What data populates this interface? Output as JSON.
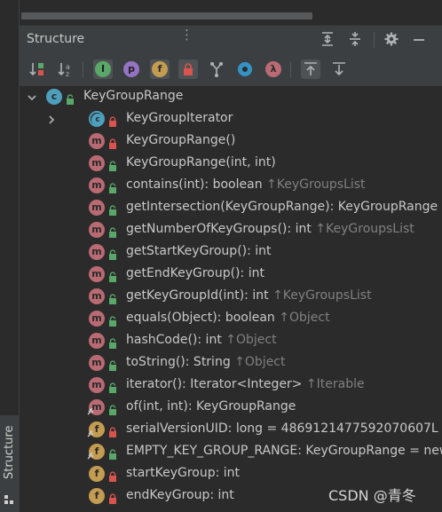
{
  "panel": {
    "title": "Structure",
    "more_glyph": "⋮",
    "colors": {
      "method": "#b96a72",
      "field": "#c39c51",
      "class": "#4e9fbd",
      "public": "#59a869",
      "private": "#d9534f",
      "selected_toggle": "#4e5254"
    }
  },
  "header_buttons": [
    "expand-all-icon",
    "collapse-all-icon",
    "gear-icon",
    "minimize-icon"
  ],
  "toolbar": [
    {
      "name": "sort-by-visibility-button",
      "icon": "sort-visibility-icon",
      "active": false
    },
    {
      "name": "sort-alphabetically-button",
      "icon": "sort-alpha-icon",
      "active": false
    },
    {
      "name": "show-inherited-button",
      "icon": "inherited-icon",
      "active": true
    },
    {
      "name": "show-properties-button",
      "icon": "property-icon",
      "active": false
    },
    {
      "name": "show-fields-button",
      "icon": "field-icon",
      "active": true
    },
    {
      "name": "show-non-public-button",
      "icon": "lock-icon",
      "active": true
    },
    {
      "name": "show-anonymous-button",
      "icon": "anonymous-icon",
      "active": false
    },
    {
      "name": "show-inherited-from-object-button",
      "icon": "object-icon",
      "active": false
    },
    {
      "name": "show-lambdas-button",
      "icon": "lambda-icon",
      "active": false
    },
    {
      "name": "autoscroll-to-source-button",
      "icon": "autoscroll-to-source-icon",
      "active": true
    },
    {
      "name": "autoscroll-from-source-button",
      "icon": "autoscroll-from-source-icon",
      "active": false
    }
  ],
  "toolbar_glyphs": {
    "inherited": "I",
    "property": "p",
    "field": "f",
    "lambda": "λ"
  },
  "tree": [
    {
      "text": "KeyGroupRange",
      "inherited": "",
      "kind": "class",
      "access": "public",
      "level": 0,
      "expander": "expanded",
      "overlay": ""
    },
    {
      "text": "KeyGroupIterator",
      "inherited": "",
      "kind": "class-inner",
      "access": "private",
      "level": 1,
      "expander": "collapsed",
      "overlay": ""
    },
    {
      "text": "KeyGroupRange()",
      "inherited": "",
      "kind": "method",
      "access": "private",
      "level": 1,
      "expander": "",
      "overlay": ""
    },
    {
      "text": "KeyGroupRange(int, int)",
      "inherited": "",
      "kind": "method",
      "access": "public",
      "level": 1,
      "expander": "",
      "overlay": ""
    },
    {
      "text": "contains(int): boolean ",
      "inherited": "↑KeyGroupsList",
      "kind": "method",
      "access": "public",
      "level": 1,
      "expander": "",
      "overlay": ""
    },
    {
      "text": "getIntersection(KeyGroupRange): KeyGroupRange",
      "inherited": "",
      "kind": "method",
      "access": "public",
      "level": 1,
      "expander": "",
      "overlay": ""
    },
    {
      "text": "getNumberOfKeyGroups(): int ",
      "inherited": "↑KeyGroupsList",
      "kind": "method",
      "access": "public",
      "level": 1,
      "expander": "",
      "overlay": ""
    },
    {
      "text": "getStartKeyGroup(): int",
      "inherited": "",
      "kind": "method",
      "access": "public",
      "level": 1,
      "expander": "",
      "overlay": ""
    },
    {
      "text": "getEndKeyGroup(): int",
      "inherited": "",
      "kind": "method",
      "access": "public",
      "level": 1,
      "expander": "",
      "overlay": ""
    },
    {
      "text": "getKeyGroupId(int): int ",
      "inherited": "↑KeyGroupsList",
      "kind": "method",
      "access": "public",
      "level": 1,
      "expander": "",
      "overlay": ""
    },
    {
      "text": "equals(Object): boolean ",
      "inherited": "↑Object",
      "kind": "method",
      "access": "public",
      "level": 1,
      "expander": "",
      "overlay": ""
    },
    {
      "text": "hashCode(): int ",
      "inherited": "↑Object",
      "kind": "method",
      "access": "public",
      "level": 1,
      "expander": "",
      "overlay": ""
    },
    {
      "text": "toString(): String ",
      "inherited": "↑Object",
      "kind": "method",
      "access": "public",
      "level": 1,
      "expander": "",
      "overlay": ""
    },
    {
      "text": "iterator(): Iterator<Integer> ",
      "inherited": "↑Iterable",
      "kind": "method",
      "access": "public",
      "level": 1,
      "expander": "",
      "overlay": ""
    },
    {
      "text": "of(int, int): KeyGroupRange",
      "inherited": "",
      "kind": "method",
      "access": "public",
      "level": 1,
      "expander": "",
      "overlay": "static"
    },
    {
      "text": "serialVersionUID: long = 4869121477592070607L",
      "inherited": "",
      "kind": "field",
      "access": "private",
      "level": 1,
      "expander": "",
      "overlay": "static"
    },
    {
      "text": "EMPTY_KEY_GROUP_RANGE: KeyGroupRange = new",
      "inherited": "",
      "kind": "field",
      "access": "public",
      "level": 1,
      "expander": "",
      "overlay": "static"
    },
    {
      "text": "startKeyGroup: int",
      "inherited": "",
      "kind": "field",
      "access": "private",
      "level": 1,
      "expander": "",
      "overlay": ""
    },
    {
      "text": "endKeyGroup: int",
      "inherited": "",
      "kind": "field",
      "access": "private",
      "level": 1,
      "expander": "",
      "overlay": ""
    }
  ],
  "tool_window_tab": "Structure",
  "watermark": "CSDN @青冬"
}
